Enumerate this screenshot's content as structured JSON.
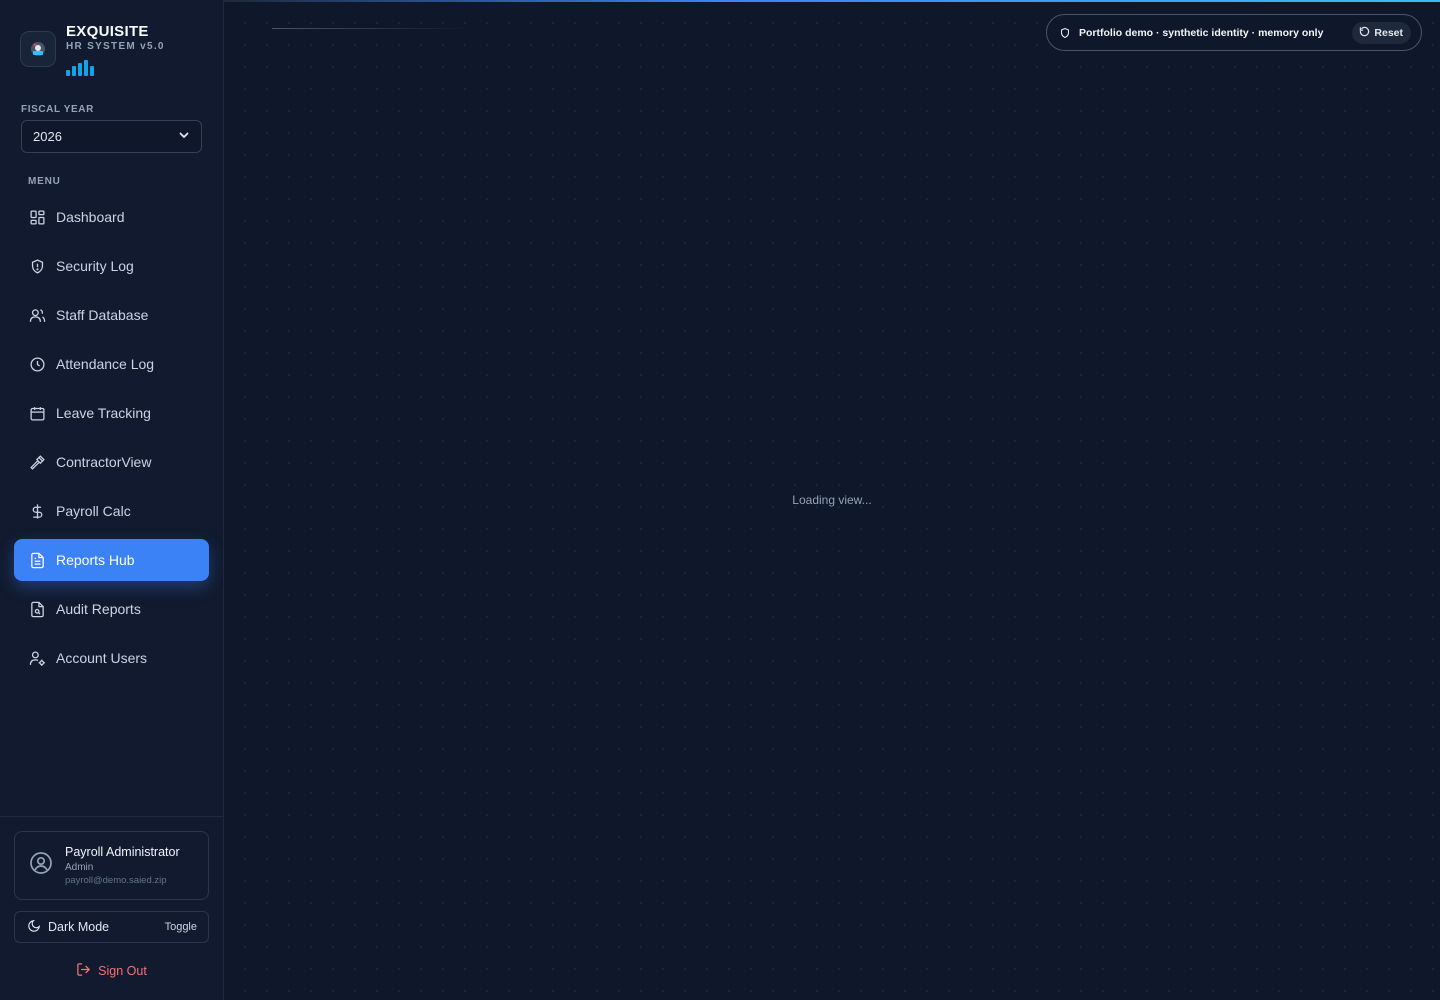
{
  "brand": {
    "title": "EXQUISITE",
    "subtitle": "HR SYSTEM v5.0"
  },
  "fiscal_year": {
    "label": "FISCAL YEAR",
    "value": "2026"
  },
  "menu": {
    "label": "MENU",
    "items": [
      {
        "label": "Dashboard",
        "icon": "grid-icon",
        "active": false
      },
      {
        "label": "Security Log",
        "icon": "shield-icon",
        "active": false
      },
      {
        "label": "Staff Database",
        "icon": "users-icon",
        "active": false
      },
      {
        "label": "Attendance Log",
        "icon": "clock-icon",
        "active": false
      },
      {
        "label": "Leave Tracking",
        "icon": "calendar-icon",
        "active": false
      },
      {
        "label": "ContractorView",
        "icon": "hammer-icon",
        "active": false
      },
      {
        "label": "Payroll Calc",
        "icon": "dollar-icon",
        "active": false
      },
      {
        "label": "Reports Hub",
        "icon": "file-text-icon",
        "active": true
      },
      {
        "label": "Audit Reports",
        "icon": "file-search-icon",
        "active": false
      },
      {
        "label": "Account Users",
        "icon": "user-cog-icon",
        "active": false
      }
    ]
  },
  "user": {
    "name": "Payroll Administrator",
    "role": "Admin",
    "email": "payroll@demo.saied.zip"
  },
  "dark_mode": {
    "label": "Dark Mode",
    "action": "Toggle"
  },
  "sign_out": "Sign Out",
  "demo_banner": {
    "text": "Portfolio demo · synthetic identity · memory only",
    "reset_label": "Reset"
  },
  "main": {
    "loading_text": "Loading view..."
  },
  "colors": {
    "accent": "#3b82f6",
    "background": "#0f172a",
    "sidebar": "#111a2e",
    "danger": "#f87171"
  }
}
